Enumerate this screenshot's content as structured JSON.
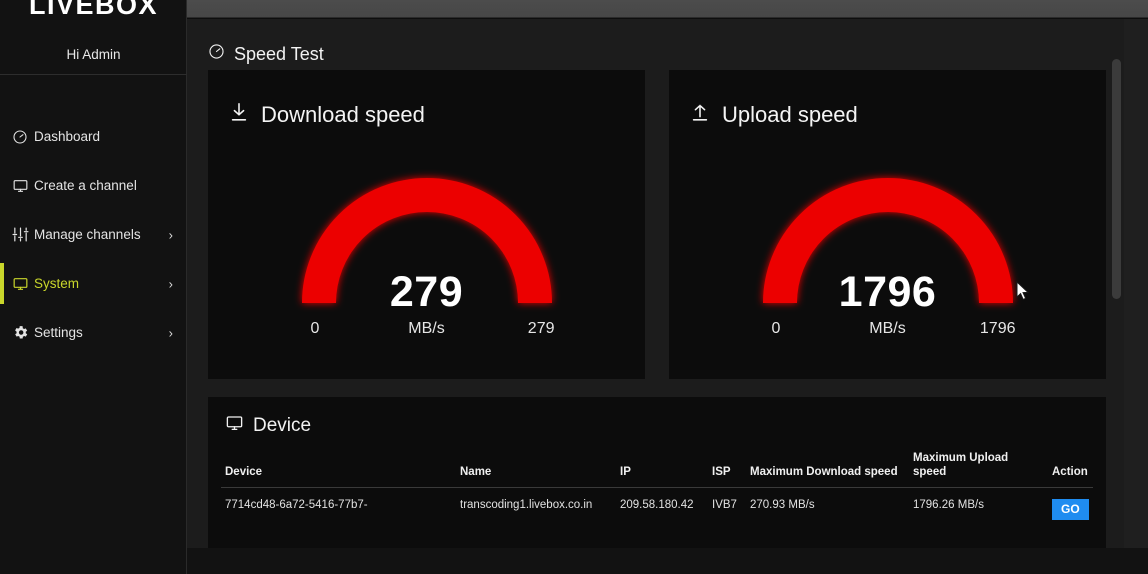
{
  "brand": {
    "logo": "LIVEBOX",
    "greeting": "Hi Admin"
  },
  "sidebar": {
    "items": [
      {
        "label": "Dashboard",
        "icon": "speedometer-icon",
        "chevron": "",
        "active": false
      },
      {
        "label": "Create a channel",
        "icon": "monitor-icon",
        "chevron": "",
        "active": false
      },
      {
        "label": "Manage channels",
        "icon": "sliders-icon",
        "chevron": "›",
        "active": false
      },
      {
        "label": "System",
        "icon": "monitor-icon",
        "chevron": "›",
        "active": true
      },
      {
        "label": "Settings",
        "icon": "gear-icon",
        "chevron": "›",
        "active": false
      }
    ]
  },
  "page": {
    "title": "Speed Test",
    "title_icon": "speedometer-icon"
  },
  "speed_cards": [
    {
      "title": "Download speed",
      "icon": "download-arrow-icon",
      "value": "279",
      "min": "0",
      "max": "279",
      "unit": "MB/s",
      "arc_color": "#ec0000",
      "fill_percent": 100
    },
    {
      "title": "Upload speed",
      "icon": "upload-arrow-icon",
      "value": "1796",
      "min": "0",
      "max": "1796",
      "unit": "MB/s",
      "arc_color": "#ec0000",
      "fill_percent": 100
    }
  ],
  "device": {
    "title": "Device",
    "title_icon": "monitor-icon",
    "columns": [
      "Device",
      "Name",
      "IP",
      "ISP",
      "Maximum Download speed",
      "Maximum Upload speed",
      "Action"
    ],
    "rows": [
      {
        "device": "7714cd48-6a72-5416-77b7-",
        "name": "transcoding1.livebox.co.in",
        "ip": "209.58.180.42",
        "isp": "IVB7",
        "max_download": "270.93 MB/s",
        "max_upload": "1796.26 MB/s",
        "action": "GO"
      }
    ]
  },
  "colors": {
    "accent": "#c9d62b",
    "gauge": "#ec0000",
    "go_button": "#1f8cf0"
  }
}
